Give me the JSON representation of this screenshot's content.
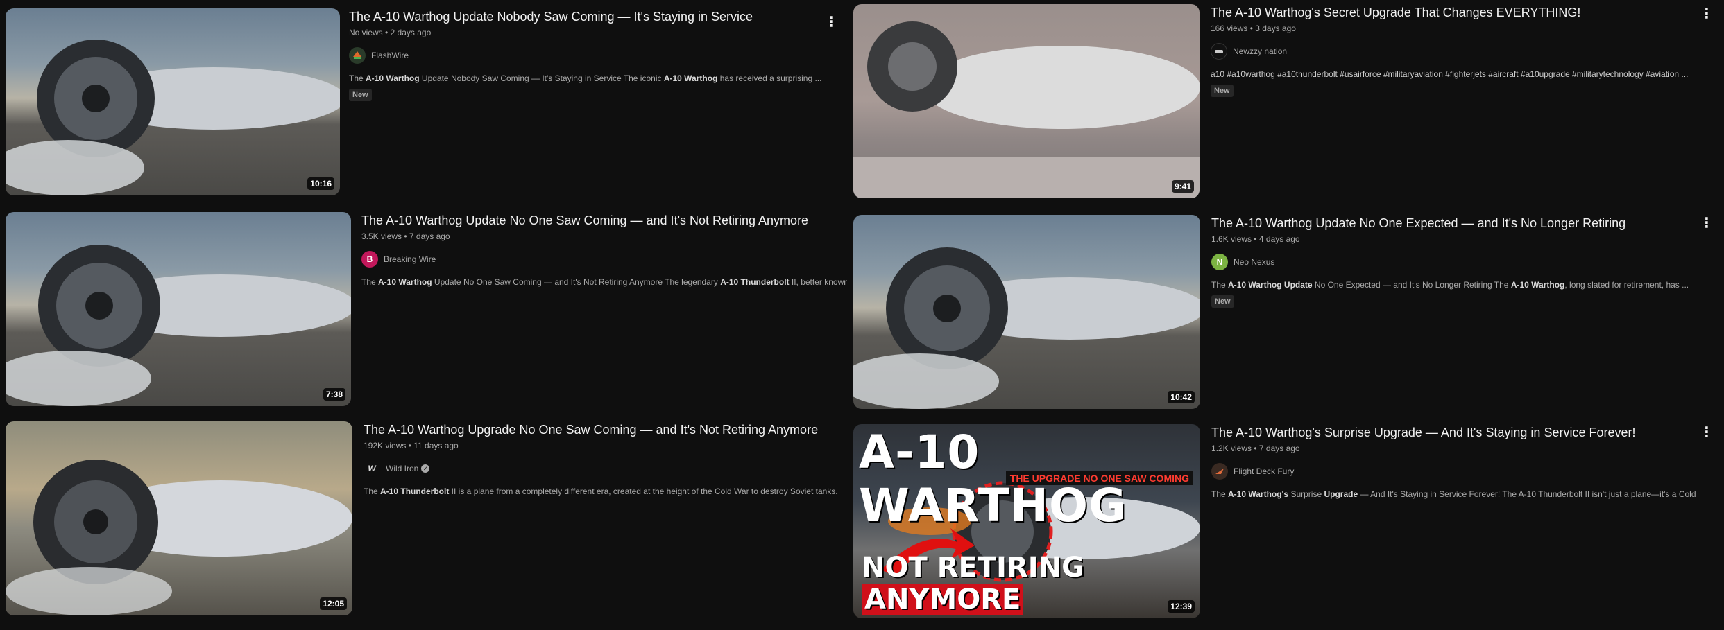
{
  "colors": {
    "background": "#0f0f0f",
    "title": "#f1f1f1",
    "secondary": "#aaaaaa"
  },
  "videos": [
    {
      "title": "The A-10 Warthog Update Nobody Saw Coming — It's Staying in Service",
      "stats": "No views • 2 days ago",
      "channel": "FlashWire",
      "avatar_letter": "",
      "avatar_color": "#2a3b2a",
      "desc_pre": "The ",
      "desc_b1": "A-10 Warthog",
      "desc_mid": " Update Nobody Saw Coming — It's Staying in Service The iconic ",
      "desc_b2": "A-10 Warthog",
      "desc_post": " has received a surprising ...",
      "badge": "New",
      "duration": "10:16"
    },
    {
      "title": "The A-10 Warthog's Secret Upgrade That Changes EVERYTHING!",
      "stats": "166 views • 3 days ago",
      "channel": "Newzzy nation",
      "avatar_letter": "",
      "avatar_color": "#111111",
      "desc_pre": "a10 #a10warthog #a10thunderbolt #usairforce #militaryaviation #fighterjets #aircraft #a10upgrade #militarytechnology #aviation ...",
      "desc_b1": "",
      "desc_mid": "",
      "desc_b2": "",
      "desc_post": "",
      "badge": "New",
      "duration": "9:41"
    },
    {
      "title": "The A-10 Warthog Update No One Saw Coming — and It's Not Retiring Anymore",
      "stats": "3.5K views • 7 days ago",
      "channel": "Breaking Wire",
      "avatar_letter": "B",
      "avatar_color": "#c2185b",
      "desc_pre": "The ",
      "desc_b1": "A-10 Warthog",
      "desc_mid": " Update No One Saw Coming — and It's Not Retiring Anymore The legendary ",
      "desc_b2": "A-10 Thunderbolt",
      "desc_post": " II, better known ...",
      "badge": "",
      "duration": "7:38"
    },
    {
      "title": "The A-10 Warthog Update No One Expected — and It's No Longer Retiring",
      "stats": "1.6K views • 4 days ago",
      "channel": "Neo Nexus",
      "avatar_letter": "N",
      "avatar_color": "#7cb342",
      "desc_pre": "The ",
      "desc_b1": "A-10 Warthog Update",
      "desc_mid": " No One Expected — and It's No Longer Retiring The ",
      "desc_b2": "A-10 Warthog",
      "desc_post": ", long slated for retirement, has ...",
      "badge": "New",
      "duration": "10:42"
    },
    {
      "title": "The A-10 Warthog Upgrade No One Saw Coming — and It's Not Retiring Anymore",
      "stats": "192K views • 11 days ago",
      "channel": "Wild Iron",
      "avatar_letter": "W",
      "avatar_color": "#0f0f0f",
      "desc_pre": "The ",
      "desc_b1": "A-10 Thunderbolt",
      "desc_mid": " II is a plane from a completely different era, created at the height of the Cold War to destroy Soviet tanks.",
      "desc_b2": "",
      "desc_post": "",
      "badge": "",
      "duration": "12:05"
    },
    {
      "title": "The A-10 Warthog's Surprise Upgrade — And It's Staying in Service Forever!",
      "stats": "1.2K views • 7 days ago",
      "channel": "Flight Deck Fury",
      "avatar_letter": "",
      "avatar_color": "#3a2a22",
      "desc_pre": "The ",
      "desc_b1": "A-10 Warthog's",
      "desc_mid": " Surprise ",
      "desc_b2": "Upgrade",
      "desc_post": " — And It's Staying in Service Forever! The A-10 Thunderbolt II isn't just a plane—it's a Cold ...",
      "badge": "",
      "duration": "12:39"
    }
  ],
  "thumb6_overlay": {
    "headline": "A-10 WARTHOG",
    "subhead": "THE UPGRADE NO ONE SAW COMING",
    "bottom_white": "NOT RETIRING ",
    "bottom_red": "ANYMORE"
  }
}
